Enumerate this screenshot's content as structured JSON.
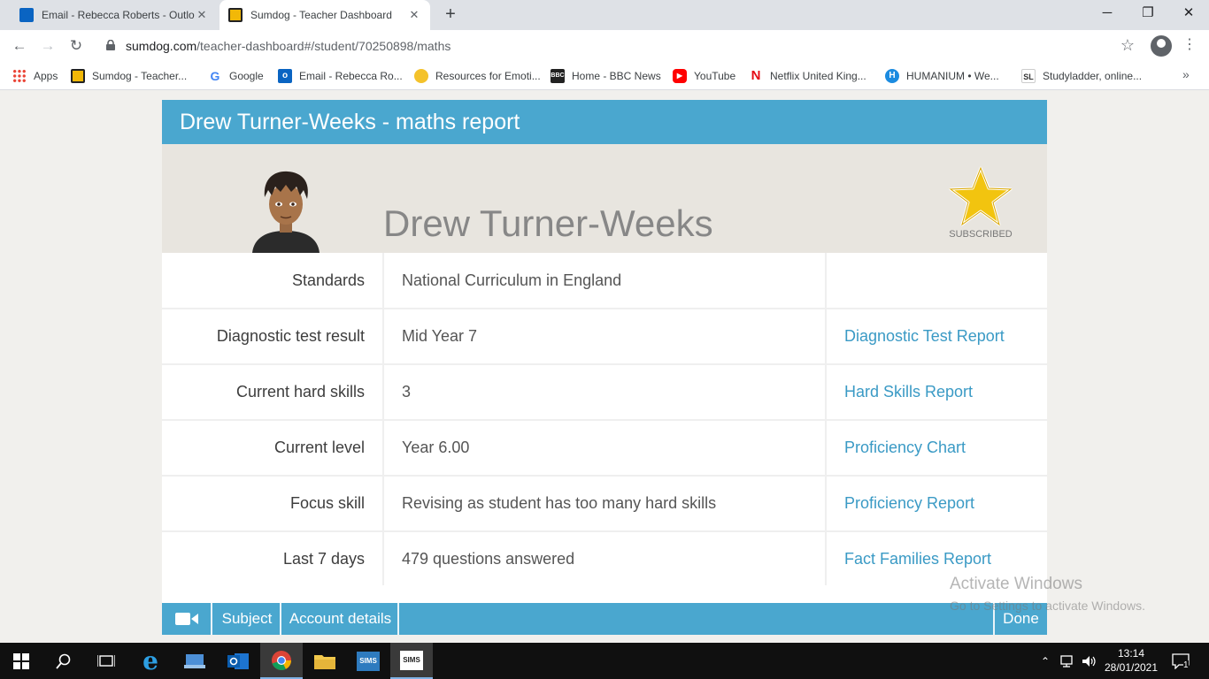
{
  "browser": {
    "tabs": [
      {
        "title": "Email - Rebecca Roberts - Outlook",
        "favicon": "outlook-icon",
        "active": false
      },
      {
        "title": "Sumdog - Teacher Dashboard",
        "favicon": "sumdog-icon",
        "active": true
      }
    ],
    "new_tab": "+",
    "window_controls": {
      "minimize": "─",
      "restore": "❐",
      "close": "✕"
    },
    "url_host": "sumdog.com",
    "url_path": "/teacher-dashboard#/student/70250898/maths",
    "bookmarks": [
      {
        "label": "Apps",
        "icon": "apps-grid-icon"
      },
      {
        "label": "Sumdog - Teacher...",
        "icon": "sumdog-icon"
      },
      {
        "label": "Google",
        "icon": "google-icon"
      },
      {
        "label": "Email - Rebecca Ro...",
        "icon": "outlook-icon"
      },
      {
        "label": "Resources for Emoti...",
        "icon": "bee-icon"
      },
      {
        "label": "Home - BBC News",
        "icon": "bbc-icon"
      },
      {
        "label": "YouTube",
        "icon": "youtube-icon"
      },
      {
        "label": "Netflix United King...",
        "icon": "netflix-icon"
      },
      {
        "label": "HUMANIUM • We...",
        "icon": "humanium-icon"
      },
      {
        "label": "Studyladder, online...",
        "icon": "studyladder-icon"
      }
    ],
    "bookmarks_more": "»"
  },
  "report": {
    "header_title": "Drew Turner-Weeks - maths report",
    "student_name": "Drew Turner-Weeks",
    "subscribed_label": "SUBSCRIBED",
    "rows": [
      {
        "label": "Standards",
        "value": "National Curriculum in England",
        "link": ""
      },
      {
        "label": "Diagnostic test result",
        "value": "Mid Year 7",
        "link": "Diagnostic Test Report"
      },
      {
        "label": "Current hard skills",
        "value": "3",
        "link": "Hard Skills Report"
      },
      {
        "label": "Current level",
        "value": "Year 6.00",
        "link": "Proficiency Chart"
      },
      {
        "label": "Focus skill",
        "value": "Revising as student has too many hard skills",
        "link": "Proficiency Report"
      },
      {
        "label": "Last 7 days",
        "value": "479 questions answered",
        "link": "Fact Families Report"
      }
    ]
  },
  "footer": {
    "video_icon": "video-camera-icon",
    "subject": "Subject",
    "account_details": "Account details",
    "done": "Done"
  },
  "watermark": {
    "line1": "Activate Windows",
    "line2": "Go to Settings to activate Windows."
  },
  "taskbar": {
    "time": "13:14",
    "date": "28/01/2021",
    "notification_count": "1",
    "sims_label": "SIMS"
  },
  "colors": {
    "accent": "#4aa7cf",
    "link": "#3a9ac5",
    "hero_bg": "#e8e5df",
    "page_bg": "#f1f0ed"
  }
}
